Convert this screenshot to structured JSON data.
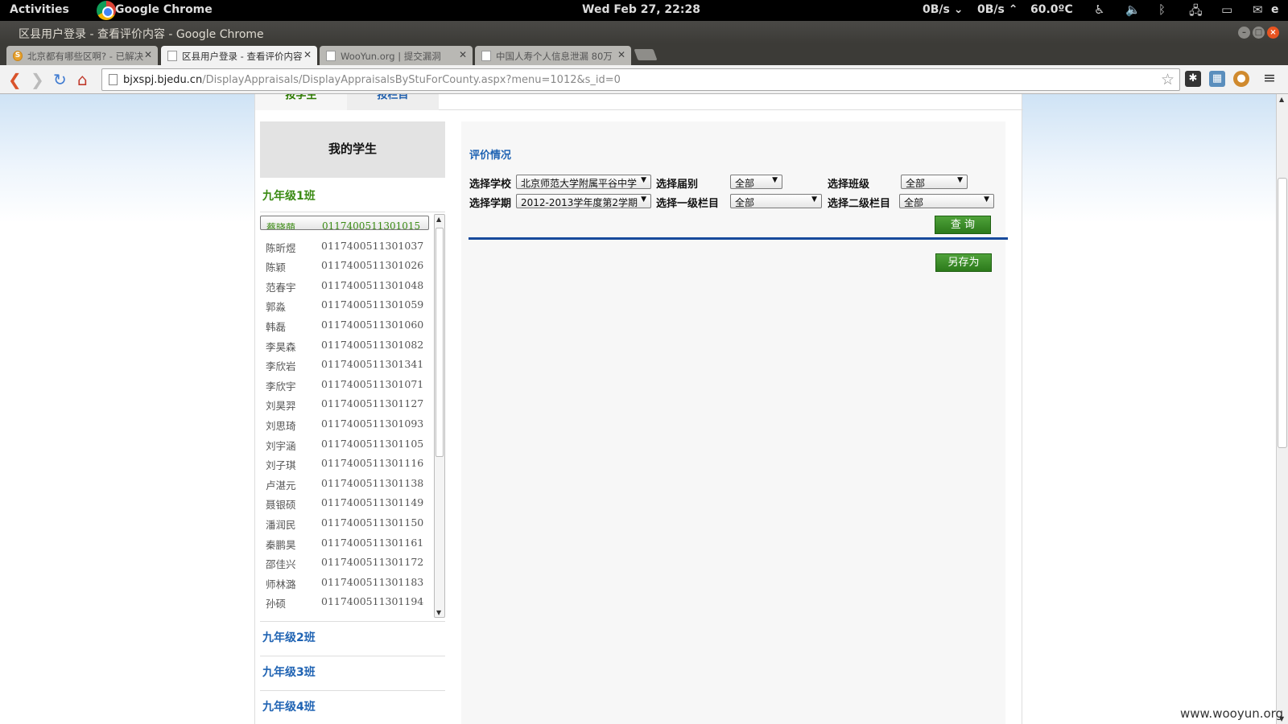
{
  "topbar": {
    "activities": "Activities",
    "app": "Google Chrome",
    "clock": "Wed Feb 27, 22:28",
    "net_down": "0B/s",
    "net_up": "0B/s",
    "temp": "60.0ºC",
    "user": "e"
  },
  "window": {
    "title": "区县用户登录 - 查看评价内容 - Google Chrome"
  },
  "tabs": [
    {
      "label": "北京都有哪些区啊? - 已解决",
      "icon": "sogou-s-icon"
    },
    {
      "label": "区县用户登录 - 查看评价内容",
      "icon": "page-icon"
    },
    {
      "label": "WooYun.org | 提交漏洞",
      "icon": "page-icon"
    },
    {
      "label": "中国人寿个人信息泄漏 80万",
      "icon": "page-icon"
    }
  ],
  "address": {
    "host": "bjxspj.bjedu.cn",
    "path": "/DisplayAppraisals/DisplayAppraisalsByStuForCounty.aspx?menu=1012&s_id=0"
  },
  "page": {
    "top_tabs": [
      "按学生",
      "按栏目"
    ],
    "sidebar": {
      "heading": "我的学生",
      "open_class": "九年级1班",
      "students": [
        {
          "name": "蔡晓萌",
          "id": "0117400511301015"
        },
        {
          "name": "陈昕煜",
          "id": "0117400511301037"
        },
        {
          "name": "陈颖",
          "id": "0117400511301026"
        },
        {
          "name": "范春宇",
          "id": "0117400511301048"
        },
        {
          "name": "郭淼",
          "id": "0117400511301059"
        },
        {
          "name": "韩磊",
          "id": "0117400511301060"
        },
        {
          "name": "李昊森",
          "id": "0117400511301082"
        },
        {
          "name": "李欣岩",
          "id": "0117400511301341"
        },
        {
          "name": "李欣宇",
          "id": "0117400511301071"
        },
        {
          "name": "刘昊羿",
          "id": "0117400511301127"
        },
        {
          "name": "刘思琦",
          "id": "0117400511301093"
        },
        {
          "name": "刘宇涵",
          "id": "0117400511301105"
        },
        {
          "name": "刘子琪",
          "id": "0117400511301116"
        },
        {
          "name": "卢湛元",
          "id": "0117400511301138"
        },
        {
          "name": "聂银硕",
          "id": "0117400511301149"
        },
        {
          "name": "潘润民",
          "id": "0117400511301150"
        },
        {
          "name": "秦鹏昊",
          "id": "0117400511301161"
        },
        {
          "name": "邵佳兴",
          "id": "0117400511301172"
        },
        {
          "name": "师林潞",
          "id": "0117400511301183"
        },
        {
          "name": "孙硕",
          "id": "0117400511301194"
        }
      ],
      "other_classes": [
        "九年级2班",
        "九年级3班",
        "九年级4班"
      ]
    },
    "main": {
      "section_title": "评价情况",
      "filters": {
        "school_label": "选择学校",
        "school_value": "北京师范大学附属平谷中学",
        "grade_label": "选择届别",
        "grade_value": "全部",
        "class_label": "选择班级",
        "class_value": "全部",
        "term_label": "选择学期",
        "term_value": "2012-2013学年度第2学期",
        "cat1_label": "选择一级栏目",
        "cat1_value": "全部",
        "cat2_label": "选择二级栏目",
        "cat2_value": "全部"
      },
      "query_button": "查 询",
      "save_as_button": "另存为"
    }
  },
  "watermark": "www.wooyun.org"
}
